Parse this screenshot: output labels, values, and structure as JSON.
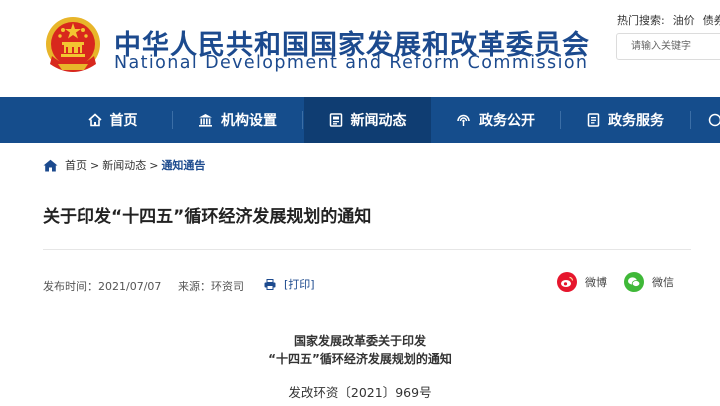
{
  "header": {
    "title_cn": "中华人民共和国国家发展和改革委员会",
    "title_en": "National Development and Reform Commission",
    "hot_search_label": "热门搜索:",
    "hot_search_terms": [
      "油价",
      "债券"
    ],
    "search_placeholder": "请输入关键字"
  },
  "nav": {
    "items": [
      {
        "label": "首页",
        "icon": "home-icon"
      },
      {
        "label": "机构设置",
        "icon": "institution-icon"
      },
      {
        "label": "新闻动态",
        "icon": "news-icon",
        "active": true
      },
      {
        "label": "政务公开",
        "icon": "broadcast-icon"
      },
      {
        "label": "政务服务",
        "icon": "document-icon"
      }
    ]
  },
  "breadcrumb": {
    "items": [
      "首页",
      "新闻动态",
      "通知通告"
    ],
    "separator": ">"
  },
  "article": {
    "title": "关于印发“十四五”循环经济发展规划的通知",
    "publish_time": "发布时间：2021/07/07",
    "source": "来源：环资司",
    "print_label": "[打印]",
    "share_weibo": "微博",
    "share_wechat": "微信",
    "doc_head_line1": "国家发展改革委关于印发",
    "doc_head_line2": "“十四五”循环经济发展规划的通知",
    "doc_number": "发改环资〔2021〕969号"
  },
  "colors": {
    "brand_blue": "#1c4a8e",
    "nav_bg": "#154d8c",
    "nav_active_bg": "#0f3d72",
    "weibo_red": "#e6162d",
    "wechat_green": "#3fb838"
  }
}
